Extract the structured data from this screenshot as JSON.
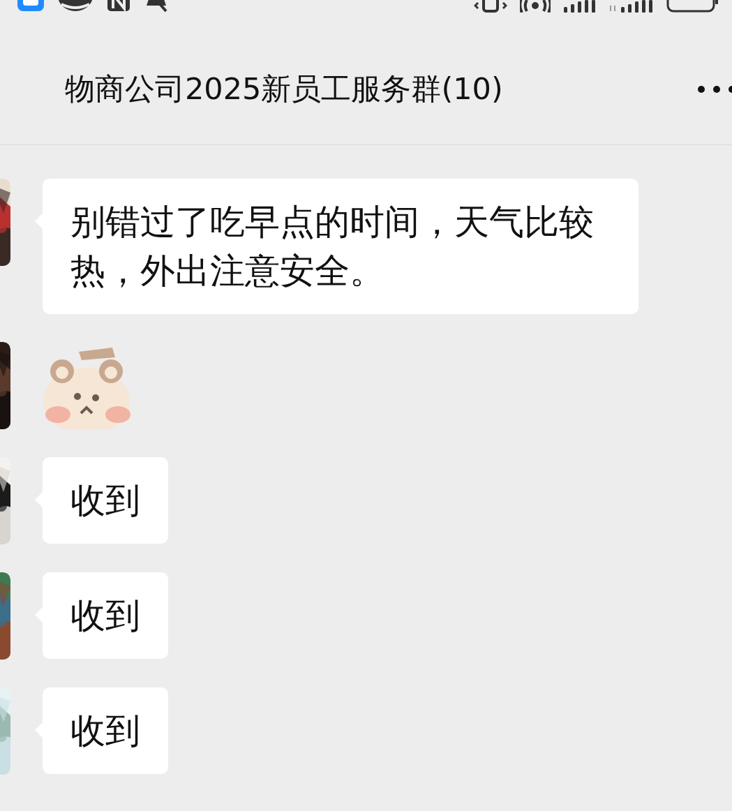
{
  "header": {
    "title": "物商公司2025新员工服务群(10)"
  },
  "messages": [
    {
      "kind": "text",
      "text": "别错过了吃早点的时间，天气比较热，外出注意安全。"
    },
    {
      "kind": "sticker"
    },
    {
      "kind": "text",
      "text": "收到"
    },
    {
      "kind": "text",
      "text": "收到"
    },
    {
      "kind": "text",
      "text": "收到"
    }
  ]
}
